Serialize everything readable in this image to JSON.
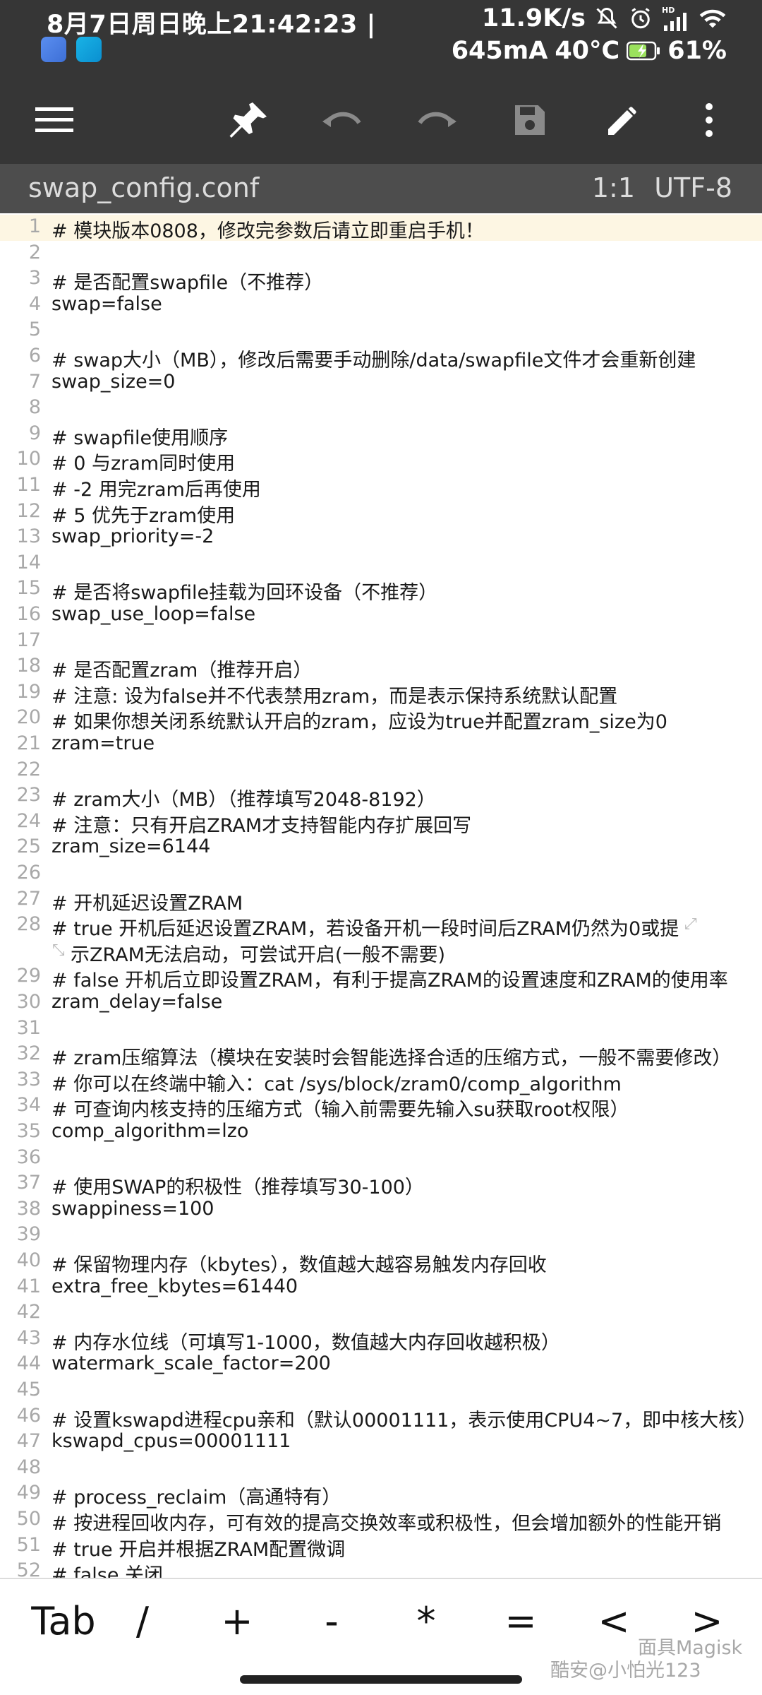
{
  "status_bar": {
    "datetime": "8月7日周日晚上21:42:23 |",
    "net_speed": "11.9K/s",
    "current": "645mA",
    "temperature": "40°C",
    "battery": "61%",
    "hd_label": "HD"
  },
  "toolbar": {
    "icons": [
      "menu-icon",
      "pin-icon",
      "undo-icon",
      "redo-icon",
      "save-icon",
      "edit-icon",
      "more-vert-icon"
    ]
  },
  "file_bar": {
    "filename": "swap_config.conf",
    "cursor_pos": "1:1",
    "encoding": "UTF-8"
  },
  "editor": {
    "lines": [
      {
        "n": "1",
        "text": "# 模块版本0808，修改完参数后请立即重启手机！"
      },
      {
        "n": "2",
        "text": ""
      },
      {
        "n": "3",
        "text": "# 是否配置swapfile（不推荐）"
      },
      {
        "n": "4",
        "text": "swap=false"
      },
      {
        "n": "5",
        "text": ""
      },
      {
        "n": "6",
        "text": "# swap大小（MB），修改后需要手动删除/data/swapfile文件才会重新创建"
      },
      {
        "n": "7",
        "text": "swap_size=0"
      },
      {
        "n": "8",
        "text": ""
      },
      {
        "n": "9",
        "text": "# swapfile使用顺序"
      },
      {
        "n": "10",
        "text": "# 0 与zram同时使用"
      },
      {
        "n": "11",
        "text": "# -2 用完zram后再使用"
      },
      {
        "n": "12",
        "text": "# 5 优先于zram使用"
      },
      {
        "n": "13",
        "text": "swap_priority=-2"
      },
      {
        "n": "14",
        "text": ""
      },
      {
        "n": "15",
        "text": "# 是否将swapfile挂载为回环设备（不推荐）"
      },
      {
        "n": "16",
        "text": "swap_use_loop=false"
      },
      {
        "n": "17",
        "text": ""
      },
      {
        "n": "18",
        "text": "# 是否配置zram（推荐开启）"
      },
      {
        "n": "19",
        "text": "# 注意: 设为false并不代表禁用zram，而是表示保持系统默认配置"
      },
      {
        "n": "20",
        "text": "# 如果你想关闭系统默认开启的zram，应设为true并配置zram_size为0"
      },
      {
        "n": "21",
        "text": "zram=true"
      },
      {
        "n": "22",
        "text": ""
      },
      {
        "n": "23",
        "text": "# zram大小（MB）（推荐填写2048-8192）"
      },
      {
        "n": "24",
        "text": "# 注意：只有开启ZRAM才支持智能内存扩展回写"
      },
      {
        "n": "25",
        "text": "zram_size=6144"
      },
      {
        "n": "26",
        "text": ""
      },
      {
        "n": "27",
        "text": "# 开机延迟设置ZRAM"
      },
      {
        "n": "28",
        "text": "# true 开机后延迟设置ZRAM，若设备开机一段时间后ZRAM仍然为0或提",
        "wrap": "示ZRAM无法启动，可尝试开启(一般不需要)"
      },
      {
        "n": "29",
        "text": "# false 开机后立即设置ZRAM，有利于提高ZRAM的设置速度和ZRAM的使用率"
      },
      {
        "n": "30",
        "text": "zram_delay=false"
      },
      {
        "n": "31",
        "text": ""
      },
      {
        "n": "32",
        "text": "# zram压缩算法（模块在安装时会智能选择合适的压缩方式，一般不需要修改）"
      },
      {
        "n": "33",
        "text": "# 你可以在终端中输入：cat /sys/block/zram0/comp_algorithm"
      },
      {
        "n": "34",
        "text": "# 可查询内核支持的压缩方式（输入前需要先输入su获取root权限）"
      },
      {
        "n": "35",
        "text": "comp_algorithm=lzo"
      },
      {
        "n": "36",
        "text": ""
      },
      {
        "n": "37",
        "text": "# 使用SWAP的积极性（推荐填写30-100）"
      },
      {
        "n": "38",
        "text": "swappiness=100"
      },
      {
        "n": "39",
        "text": ""
      },
      {
        "n": "40",
        "text": "# 保留物理内存（kbytes），数值越大越容易触发内存回收"
      },
      {
        "n": "41",
        "text": "extra_free_kbytes=61440"
      },
      {
        "n": "42",
        "text": ""
      },
      {
        "n": "43",
        "text": "# 内存水位线（可填写1-1000，数值越大内存回收越积极）"
      },
      {
        "n": "44",
        "text": "watermark_scale_factor=200"
      },
      {
        "n": "45",
        "text": ""
      },
      {
        "n": "46",
        "text": "# 设置kswapd进程cpu亲和（默认00001111，表示使用CPU4~7，即中核大核）"
      },
      {
        "n": "47",
        "text": "kswapd_cpus=00001111"
      },
      {
        "n": "48",
        "text": ""
      },
      {
        "n": "49",
        "text": "# process_reclaim（高通特有）"
      },
      {
        "n": "50",
        "text": "# 按进程回收内存，可有效的提高交换效率或积极性，但会增加额外的性能开销"
      },
      {
        "n": "51",
        "text": "# true 开启并根据ZRAM配置微调"
      },
      {
        "n": "52",
        "text": "# false 关闭"
      }
    ]
  },
  "key_bar": {
    "keys": [
      "Tab",
      "/",
      "+",
      "-",
      "*",
      "=",
      "<",
      ">"
    ]
  },
  "watermark": {
    "line1": "酷安@小怕光123",
    "line2": "面具Magisk"
  }
}
